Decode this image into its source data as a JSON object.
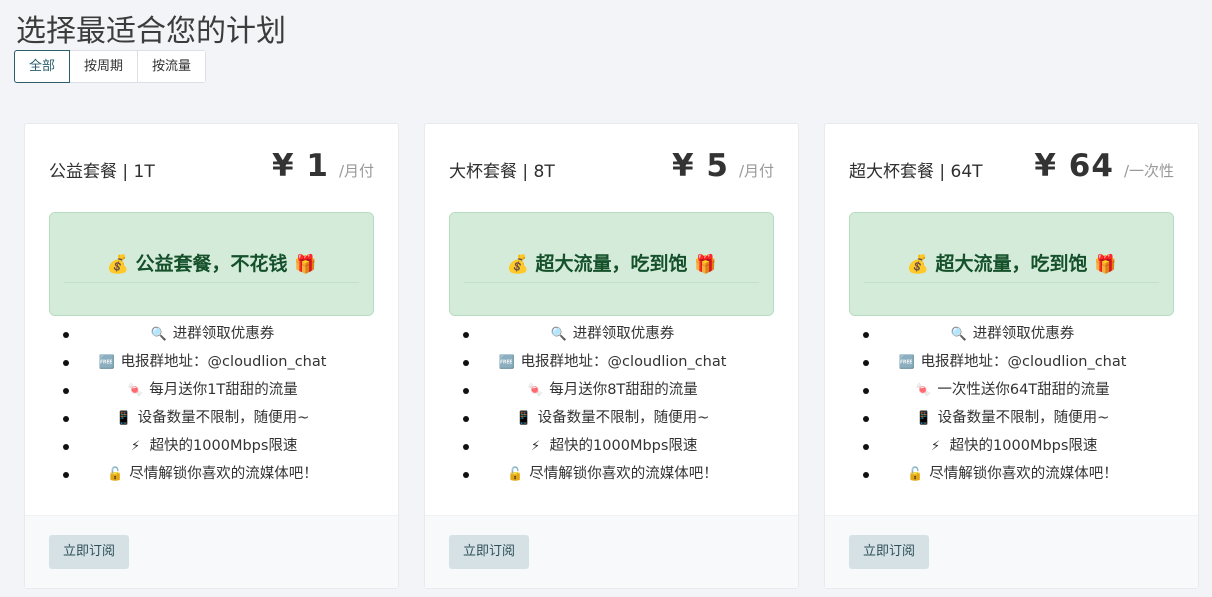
{
  "page": {
    "title": "选择最适合您的计划",
    "filters": [
      {
        "label": "全部",
        "active": true
      },
      {
        "label": "按周期",
        "active": false
      },
      {
        "label": "按流量",
        "active": false
      }
    ]
  },
  "plans": [
    {
      "name": "公益套餐 | 1T",
      "price": "¥ 1",
      "period": "/月付",
      "banner": {
        "left_icon": "💰",
        "text": "公益套餐，不花钱",
        "right_icon": "🎁"
      },
      "features": [
        {
          "icon": "🔍",
          "icon_name": "magnifier-icon",
          "text": "进群领取优惠券"
        },
        {
          "icon": "🆓",
          "icon_name": "free-badge-icon",
          "text": "电报群地址：@cloudlion_chat"
        },
        {
          "icon": "🍬",
          "icon_name": "candy-icon",
          "text": "每月送你1T甜甜的流量"
        },
        {
          "icon": "📱",
          "icon_name": "phone-icon",
          "text": "设备数量不限制，随便用~"
        },
        {
          "icon": "⚡",
          "icon_name": "lightning-icon",
          "text": "超快的1000Mbps限速"
        },
        {
          "icon": "🔓",
          "icon_name": "unlock-icon",
          "text": "尽情解锁你喜欢的流媒体吧！"
        }
      ],
      "button": "立即订阅"
    },
    {
      "name": "大杯套餐 | 8T",
      "price": "¥ 5",
      "period": "/月付",
      "banner": {
        "left_icon": "💰",
        "text": "超大流量，吃到饱",
        "right_icon": "🎁"
      },
      "features": [
        {
          "icon": "🔍",
          "icon_name": "magnifier-icon",
          "text": "进群领取优惠券"
        },
        {
          "icon": "🆓",
          "icon_name": "free-badge-icon",
          "text": "电报群地址：@cloudlion_chat"
        },
        {
          "icon": "🍬",
          "icon_name": "candy-icon",
          "text": "每月送你8T甜甜的流量"
        },
        {
          "icon": "📱",
          "icon_name": "phone-icon",
          "text": "设备数量不限制，随便用~"
        },
        {
          "icon": "⚡",
          "icon_name": "lightning-icon",
          "text": "超快的1000Mbps限速"
        },
        {
          "icon": "🔓",
          "icon_name": "unlock-icon",
          "text": "尽情解锁你喜欢的流媒体吧！"
        }
      ],
      "button": "立即订阅"
    },
    {
      "name": "超大杯套餐 | 64T",
      "price": "¥ 64",
      "period": "/一次性",
      "banner": {
        "left_icon": "💰",
        "text": "超大流量，吃到饱",
        "right_icon": "🎁"
      },
      "features": [
        {
          "icon": "🔍",
          "icon_name": "magnifier-icon",
          "text": "进群领取优惠券"
        },
        {
          "icon": "🆓",
          "icon_name": "free-badge-icon",
          "text": "电报群地址：@cloudlion_chat"
        },
        {
          "icon": "🍬",
          "icon_name": "candy-icon",
          "text": "一次性送你64T甜甜的流量"
        },
        {
          "icon": "📱",
          "icon_name": "phone-icon",
          "text": "设备数量不限制，随便用~"
        },
        {
          "icon": "⚡",
          "icon_name": "lightning-icon",
          "text": "超快的1000Mbps限速"
        },
        {
          "icon": "🔓",
          "icon_name": "unlock-icon",
          "text": "尽情解锁你喜欢的流媒体吧！"
        }
      ],
      "button": "立即订阅"
    }
  ],
  "colors": {
    "accent": "#2b5d6b",
    "banner_bg": "#d5ebd9",
    "banner_text": "#14502a",
    "button_bg": "#d5e1e4",
    "page_bg": "#f2f4f8"
  }
}
